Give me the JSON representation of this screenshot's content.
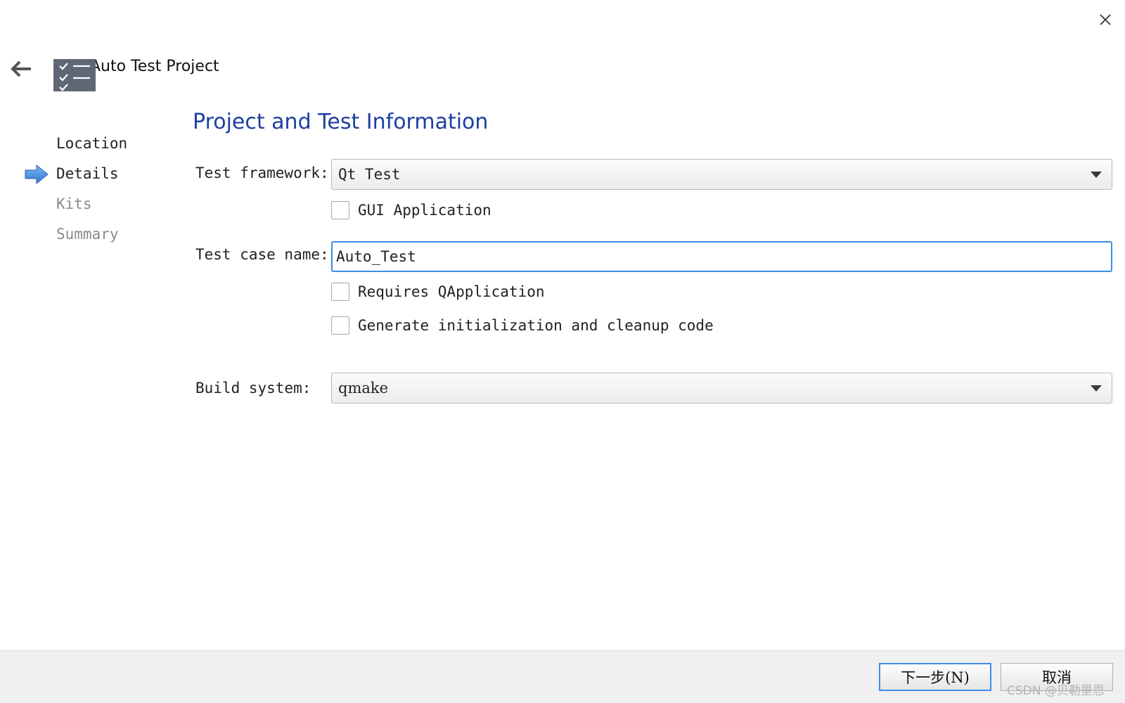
{
  "header": {
    "title": "Auto Test Project"
  },
  "sidebar": {
    "steps": [
      {
        "label": "Location",
        "state": "done"
      },
      {
        "label": "Details",
        "state": "current"
      },
      {
        "label": "Kits",
        "state": "pending"
      },
      {
        "label": "Summary",
        "state": "pending"
      }
    ]
  },
  "main": {
    "heading": "Project and Test Information",
    "test_framework": {
      "label": "Test framework:",
      "value": "Qt Test"
    },
    "gui_application": {
      "label": "GUI Application",
      "checked": false
    },
    "test_case_name": {
      "label": "Test case name:",
      "value": "Auto_Test"
    },
    "requires_qapplication": {
      "label": "Requires QApplication",
      "checked": false
    },
    "generate_init_cleanup": {
      "label": "Generate initialization and cleanup code",
      "checked": false
    },
    "build_system": {
      "label": "Build system:",
      "value": "qmake"
    }
  },
  "footer": {
    "next_label": "下一步(N)",
    "cancel_label": "取消",
    "watermark": "CSDN @贝勒里恩"
  },
  "colors": {
    "heading": "#1e3f9f",
    "focus_border": "#3c8ee8",
    "icon_bg": "#5f6675",
    "step_arrow": "#3a86e0"
  },
  "icons": {
    "close": "close-icon",
    "back": "back-arrow-icon",
    "wizard": "checklist-icon",
    "current_step": "current-step-arrow-icon"
  }
}
